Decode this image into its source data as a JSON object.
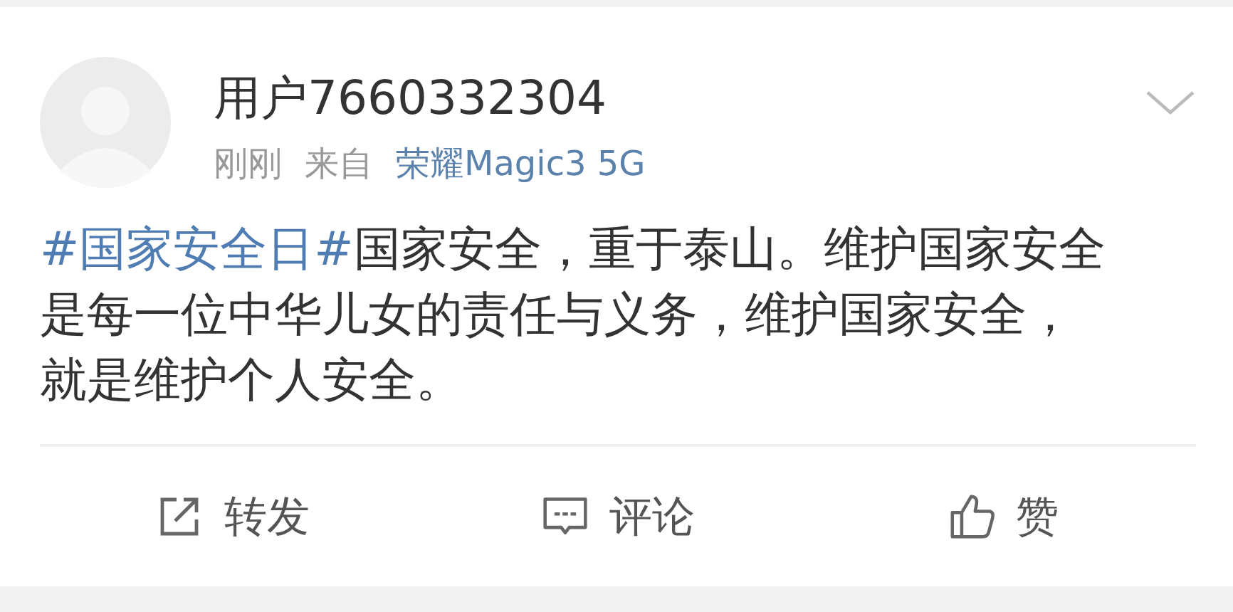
{
  "post": {
    "username": "用户7660332304",
    "time": "刚刚",
    "source_label": "来自",
    "source": "荣耀Magic3 5G",
    "hashtag": "#国家安全日#",
    "text": "国家安全，重于泰山。维护国家安全是每一位中华儿女的责任与义务，维护国家安全，就是维护个人安全。"
  },
  "actions": [
    {
      "kind": "repost",
      "label": "转发"
    },
    {
      "kind": "comment",
      "label": "评论"
    },
    {
      "kind": "like",
      "label": "赞"
    }
  ]
}
